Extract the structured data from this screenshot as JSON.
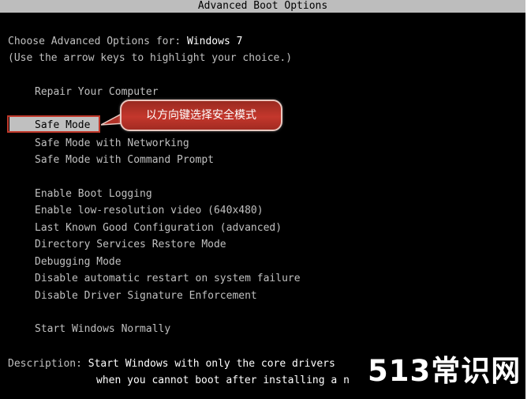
{
  "window": {
    "title": "Advanced Boot Options"
  },
  "header": {
    "choose_prefix": "Choose Advanced Options for: ",
    "os_name": "Windows 7",
    "instruction": "(Use the arrow keys to highlight your choice.)"
  },
  "menu": {
    "repair": "Repair Your Computer",
    "selected": "Safe Mode",
    "safe_mode_networking": "Safe Mode with Networking",
    "safe_mode_cmd": "Safe Mode with Command Prompt",
    "boot_logging": "Enable Boot Logging",
    "low_res_video": "Enable low-resolution video (640x480)",
    "last_known_good": "Last Known Good Configuration (advanced)",
    "ds_restore": "Directory Services Restore Mode",
    "debugging": "Debugging Mode",
    "disable_auto_restart": "Disable automatic restart on system failure",
    "disable_driver_sig": "Disable Driver Signature Enforcement",
    "start_normally": "Start Windows Normally"
  },
  "description": {
    "label": "Description: ",
    "line1": "Start Windows with only the core drivers",
    "line2": "when you cannot boot after installing a n"
  },
  "annotation": {
    "callout_text": "以方向键选择安全模式"
  },
  "watermark": {
    "text": "513常识网"
  },
  "colors": {
    "background": "#000000",
    "text": "#c0c0c0",
    "highlight_text": "#ffffff",
    "selection_bar": "#c0c0c0",
    "callout_fill": "#c4372c",
    "callout_border": "#e9c7bf"
  }
}
